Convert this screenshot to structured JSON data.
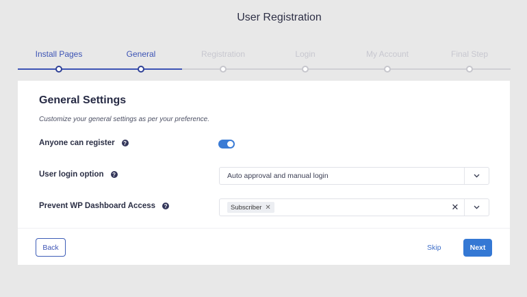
{
  "page_title": "User Registration",
  "steps": [
    {
      "label": "Install Pages",
      "state": "done"
    },
    {
      "label": "General",
      "state": "current"
    },
    {
      "label": "Registration",
      "state": "pending"
    },
    {
      "label": "Login",
      "state": "pending"
    },
    {
      "label": "My Account",
      "state": "pending"
    },
    {
      "label": "Final Step",
      "state": "pending"
    }
  ],
  "card": {
    "heading": "General Settings",
    "subtitle": "Customize your general settings as per your preference.",
    "anyone_can_register": {
      "label": "Anyone can register",
      "enabled": true,
      "help_icon": "question-circle-icon"
    },
    "user_login_option": {
      "label": "User login option",
      "value": "Auto approval and manual login",
      "help_icon": "question-circle-icon"
    },
    "prevent_dashboard": {
      "label": "Prevent WP Dashboard Access",
      "tags": [
        "Subscriber"
      ],
      "help_icon": "question-circle-icon"
    }
  },
  "footer": {
    "back_label": "Back",
    "skip_label": "Skip",
    "next_label": "Next"
  },
  "colors": {
    "accent": "#3478d4",
    "step_active": "#3b52b4",
    "step_inactive": "#c7c7cf",
    "background": "#e8e8e8"
  },
  "icons": {
    "help": "question-circle-icon",
    "dropdown": "chevron-down-icon",
    "clear": "close-icon",
    "tag_remove": "close-icon"
  }
}
